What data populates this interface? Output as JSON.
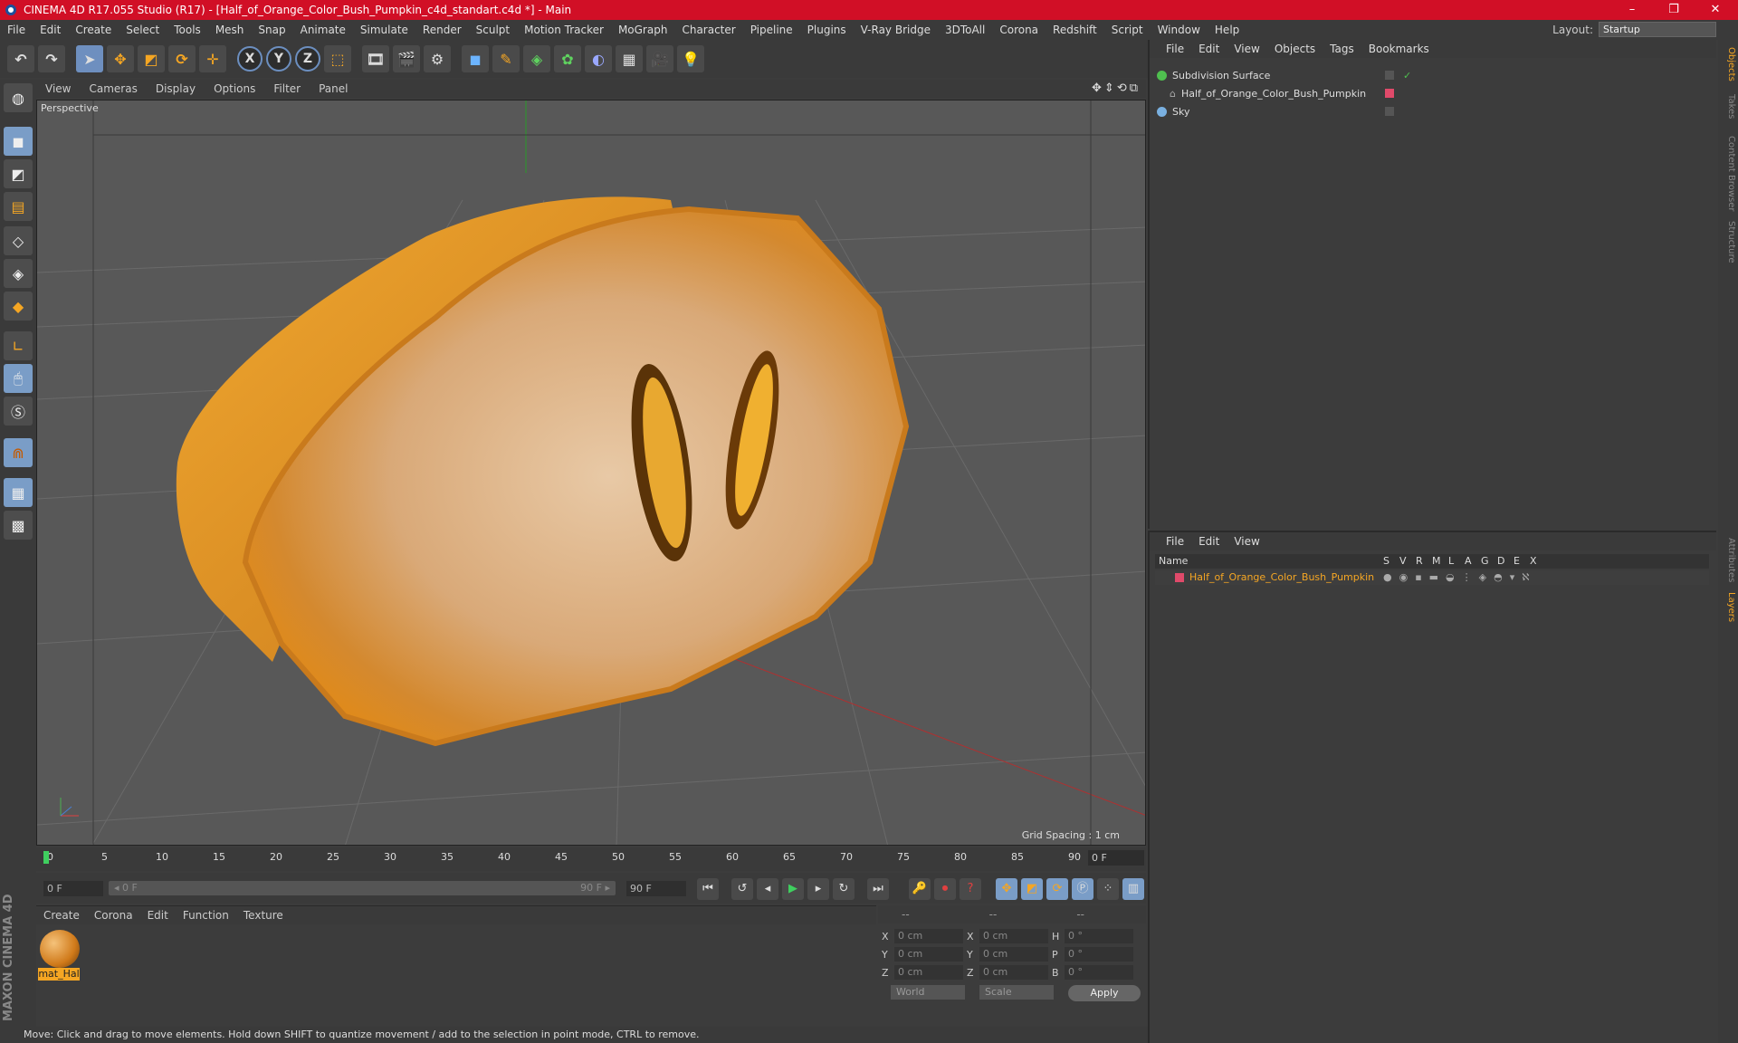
{
  "window": {
    "title": "CINEMA 4D R17.055 Studio (R17) - [Half_of_Orange_Color_Bush_Pumpkin_c4d_standart.c4d *] - Main",
    "minimize": "–",
    "maximize": "❐",
    "close": "✕"
  },
  "menu": [
    "File",
    "Edit",
    "Create",
    "Select",
    "Tools",
    "Mesh",
    "Snap",
    "Animate",
    "Simulate",
    "Render",
    "Sculpt",
    "Motion Tracker",
    "MoGraph",
    "Character",
    "Pipeline",
    "Plugins",
    "V-Ray Bridge",
    "3DToAll",
    "Corona",
    "Redshift",
    "Script",
    "Window",
    "Help"
  ],
  "layout": {
    "label": "Layout:",
    "value": "Startup"
  },
  "toolbar": {
    "undo": "↶",
    "redo": "↷",
    "axis_x": "X",
    "axis_y": "Y",
    "axis_z": "Z"
  },
  "viewport": {
    "menu": [
      "View",
      "Cameras",
      "Display",
      "Options",
      "Filter",
      "Panel"
    ],
    "camera": "Perspective",
    "grid_spacing": "Grid Spacing : 1 cm",
    "nav_icons": "✥⇕⟲⧉"
  },
  "timeline": {
    "ticks": [
      "0",
      "5",
      "10",
      "15",
      "20",
      "25",
      "30",
      "35",
      "40",
      "45",
      "50",
      "55",
      "60",
      "65",
      "70",
      "75",
      "80",
      "85",
      "90"
    ],
    "end_frame": "0 F"
  },
  "transport": {
    "start": "0 F",
    "range_start": "◂ 0 F",
    "range_end": "90 F ▸",
    "end": "90 F"
  },
  "material": {
    "menu": [
      "Create",
      "Corona",
      "Edit",
      "Function",
      "Texture"
    ],
    "name": "mat_Hal"
  },
  "coords": {
    "header": [
      "--",
      "--",
      "--"
    ],
    "rows": [
      {
        "a": "X",
        "av": "0 cm",
        "b": "X",
        "bv": "0 cm",
        "c": "H",
        "cv": "0 °"
      },
      {
        "a": "Y",
        "av": "0 cm",
        "b": "Y",
        "bv": "0 cm",
        "c": "P",
        "cv": "0 °"
      },
      {
        "a": "Z",
        "av": "0 cm",
        "b": "Z",
        "bv": "0 cm",
        "c": "B",
        "cv": "0 °"
      }
    ],
    "world": "World",
    "scale": "Scale",
    "apply": "Apply"
  },
  "status": "Move: Click and drag to move elements. Hold down SHIFT to quantize movement / add to the selection in point mode, CTRL to remove.",
  "objects": {
    "menu": [
      "File",
      "Edit",
      "View",
      "Objects",
      "Tags",
      "Bookmarks"
    ],
    "items": [
      "Subdivision Surface",
      "Half_of_Orange_Color_Bush_Pumpkin",
      "Sky"
    ]
  },
  "layers": {
    "menu": [
      "File",
      "Edit",
      "View"
    ],
    "header": {
      "name": "Name",
      "cols": [
        "S",
        "V",
        "R",
        "M",
        "L",
        "A",
        "G",
        "D",
        "E",
        "X"
      ]
    },
    "row": "Half_of_Orange_Color_Bush_Pumpkin"
  },
  "right_tabs": [
    "Objects",
    "Takes",
    "Content Browser",
    "Structure",
    "Attributes",
    "Layers"
  ],
  "brand": "MAXON CINEMA 4D",
  "colors": {
    "titlebar": "#d10f26",
    "accent_orange": "#f5a623",
    "viewport_bg": "#585858"
  }
}
